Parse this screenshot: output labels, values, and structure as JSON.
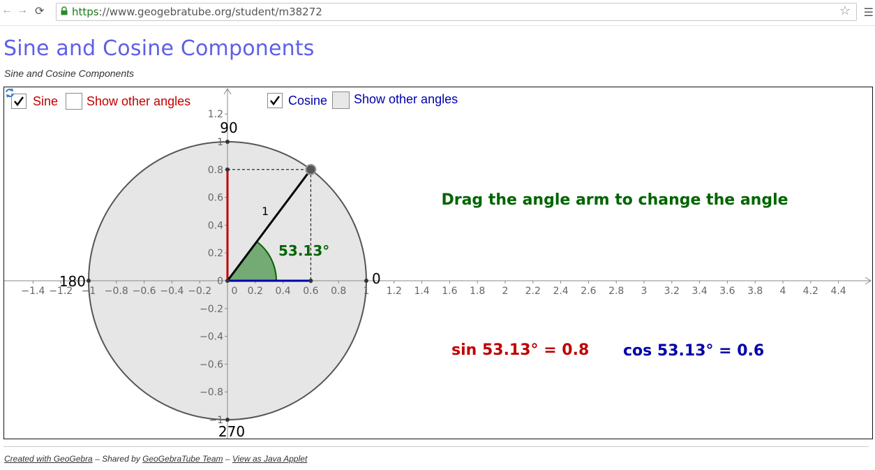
{
  "browser": {
    "url_scheme": "https",
    "url_rest": "://www.geogebratube.org/student/m38272"
  },
  "page": {
    "title": "Sine and Cosine Components",
    "subtitle": "Sine and Cosine Components"
  },
  "applet": {
    "checkbox_sine": {
      "label": "Sine",
      "checked": true
    },
    "checkbox_sine_other": {
      "label": "Show other angles",
      "checked": false
    },
    "checkbox_cosine": {
      "label": "Cosine",
      "checked": true
    },
    "checkbox_cosine_other": {
      "label": "Show other angles",
      "checked": false
    },
    "instruction": "Drag the angle arm to change the angle",
    "angle_label": "53.13°",
    "radius_label": "1",
    "sin_text": "sin 53.13° = 0.8",
    "cos_text": "cos 53.13° = 0.6",
    "degree_labels": [
      "0",
      "90",
      "180",
      "270"
    ],
    "x_ticks": [
      "−1.4",
      "−1.2",
      "−1",
      "−0.8",
      "−0.6",
      "−0.4",
      "−0.2",
      "0",
      "0.2",
      "0.4",
      "0.6",
      "0.8",
      "1",
      "1.2",
      "1.4",
      "1.6",
      "1.8",
      "2",
      "2.2",
      "2.4",
      "2.6",
      "2.8",
      "3",
      "3.2",
      "3.4",
      "3.6",
      "3.8",
      "4",
      "4.2",
      "4.4"
    ],
    "y_ticks": [
      "1.2",
      "1",
      "0.8",
      "0.6",
      "0.4",
      "0.2",
      "0",
      "−0.2",
      "−0.4",
      "−0.6",
      "−0.8",
      "−1"
    ],
    "colors": {
      "sine": "#c00000",
      "cosine": "#0000aa",
      "angle": "#006400",
      "instruction": "#006400",
      "circle_fill": "#e6e6e6"
    }
  },
  "footer": {
    "created": "Created with GeoGebra",
    "shared_by_prefix": " – Shared by ",
    "team": "GeoGebraTube Team",
    "sep": " – ",
    "java": "View as Java Applet"
  }
}
